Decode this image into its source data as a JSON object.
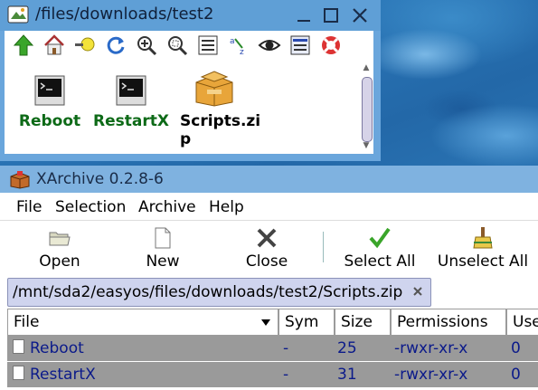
{
  "rox_window": {
    "title": "/files/downloads/test2",
    "toolbar_icons": [
      "up-arrow-icon",
      "home-icon",
      "bookmark-bulb-icon",
      "refresh-icon",
      "zoom-in-icon",
      "zoom-fit-icon",
      "details-list-icon",
      "sort-az-icon",
      "eye-show-hidden-icon",
      "options-list-icon",
      "help-lifebuoy-icon"
    ],
    "files": [
      {
        "name": "Reboot",
        "type": "executable"
      },
      {
        "name": "RestartX",
        "type": "executable"
      },
      {
        "name_line1": "Scripts.zi",
        "name_line2": "p",
        "type": "archive"
      }
    ]
  },
  "xarchive_window": {
    "title": "XArchive 0.2.8-6",
    "menu": {
      "file": "File",
      "selection": "Selection",
      "archive": "Archive",
      "help": "Help"
    },
    "toolbar": {
      "open": "Open",
      "new": "New",
      "close": "Close",
      "select_all": "Select All",
      "unselect_all": "Unselect All"
    },
    "path_tab": "/mnt/sda2/easyos/files/downloads/test2/Scripts.zip",
    "columns": {
      "file": "File",
      "sym": "Sym",
      "size": "Size",
      "permissions": "Permissions",
      "user": "Use"
    },
    "rows": [
      {
        "file": "Reboot",
        "sym": "-",
        "size": "25",
        "permissions": "-rwxr-xr-x",
        "user": "0"
      },
      {
        "file": "RestartX",
        "sym": "-",
        "size": "31",
        "permissions": "-rwxr-xr-x",
        "user": "0"
      }
    ]
  },
  "colors": {
    "exec_label": "#0d6a17",
    "selected_row": "#9a9a9a",
    "row_text": "#0b1a8a",
    "titlebar": "#5f9fd6"
  }
}
